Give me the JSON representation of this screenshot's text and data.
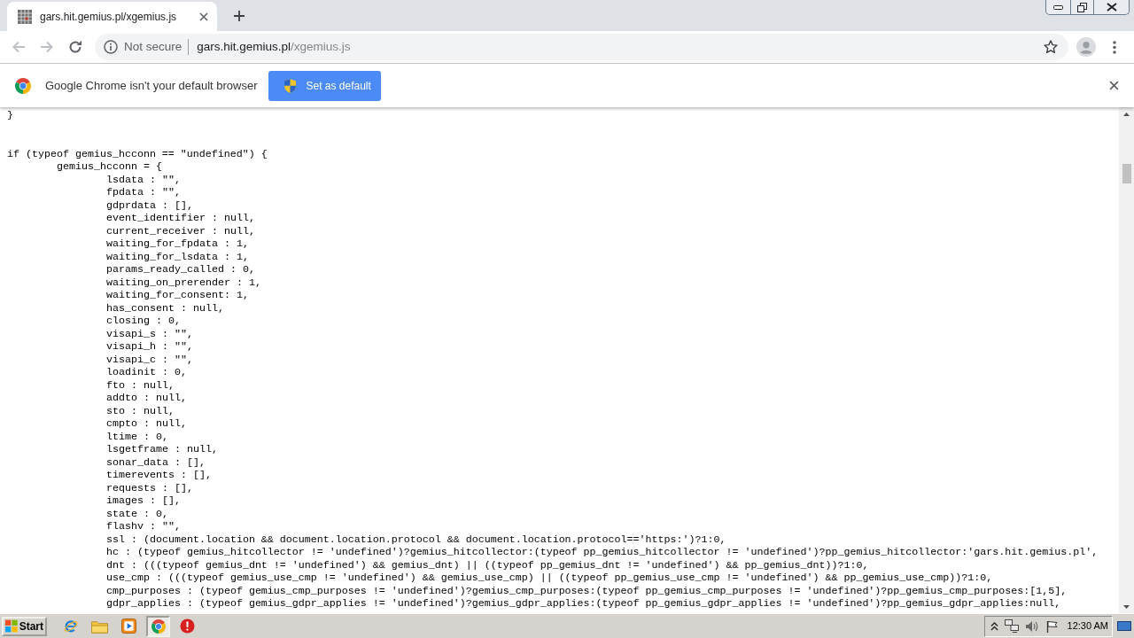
{
  "tabs": [
    {
      "title": "gars.hit.gemius.pl/xgemius.js",
      "selected": true
    }
  ],
  "toolbar": {
    "back": {
      "disabled": true
    },
    "forward": {
      "disabled": true
    },
    "omnibox": {
      "security": "Not secure",
      "host": "gars.hit.gemius.pl",
      "path": "/xgemius.js",
      "bookmarked": false
    }
  },
  "infobar": {
    "message": "Google Chrome isn't your default browser",
    "button": "Set as default"
  },
  "code": [
    [
      {
        "text": "}"
      }
    ],
    [
      {
        "text": "if (typeof gemius_hcconn == \"undefined\") {",
        "children": [
          {
            "text": "gemius_hcconn = {",
            "children": [
              {
                "text": "lsdata : \"\","
              },
              {
                "text": "fpdata : \"\","
              },
              {
                "text": "gdprdata : [],"
              },
              {
                "text": "event_identifier : null,"
              },
              {
                "text": "current_receiver : null,"
              },
              {
                "text": "waiting_for_fpdata : 1,"
              },
              {
                "text": "waiting_for_lsdata : 1,"
              },
              {
                "text": "params_ready_called : 0,"
              },
              {
                "text": "waiting_on_prerender : 1,"
              },
              {
                "text": "waiting_for_consent: 1,"
              },
              {
                "text": "has_consent : null,"
              },
              {
                "text": "closing : 0,"
              },
              {
                "text": "visapi_s : \"\","
              },
              {
                "text": "visapi_h : \"\","
              },
              {
                "text": "visapi_c : \"\","
              },
              {
                "text": "loadinit : 0,"
              },
              {
                "text": "fto : null,"
              },
              {
                "text": "addto : null,"
              },
              {
                "text": "sto : null,"
              },
              {
                "text": "cmpto : null,"
              },
              {
                "text": "ltime : 0,"
              },
              {
                "text": "lsgetframe : null,"
              },
              {
                "text": "sonar_data : [],"
              },
              {
                "text": "timerevents : [],"
              },
              {
                "text": "requests : [],"
              },
              {
                "text": "images : [],"
              },
              {
                "text": "state : 0,"
              },
              {
                "text": "flashv : \"\","
              },
              {
                "text": "ssl : (document.location && document.location.protocol && document.location.protocol=='https:')?1:0,"
              },
              {
                "text": "hc : (typeof gemius_hitcollector != 'undefined')?gemius_hitcollector:(typeof pp_gemius_hitcollector != 'undefined')?pp_gemius_hitcollector:'gars.hit.gemius.pl',"
              },
              {
                "text": "dnt : (((typeof gemius_dnt != 'undefined') && gemius_dnt) || ((typeof pp_gemius_dnt != 'undefined') && pp_gemius_dnt))?1:0,"
              },
              {
                "text": "use_cmp : (((typeof gemius_use_cmp != 'undefined') && gemius_use_cmp) || ((typeof pp_gemius_use_cmp != 'undefined') && pp_gemius_use_cmp))?1:0,"
              },
              {
                "text": "cmp_purposes : (typeof gemius_cmp_purposes != 'undefined')?gemius_cmp_purposes:(typeof pp_gemius_cmp_purposes != 'undefined')?pp_gemius_cmp_purposes:[1,5],"
              },
              {
                "text": "gdpr_applies : (typeof gemius_gdpr_applies != 'undefined')?gemius_gdpr_applies:(typeof pp_gemius_gdpr_applies != 'undefined')?pp_gemius_gdpr_applies:null,"
              }
            ]
          }
        ]
      }
    ]
  ],
  "taskbar": {
    "start": "Start",
    "apps": [
      {
        "kind": "ie",
        "active": false
      },
      {
        "kind": "folder",
        "active": false
      },
      {
        "kind": "media",
        "active": false
      },
      {
        "kind": "chrome",
        "active": true
      },
      {
        "kind": "alert",
        "active": false
      }
    ],
    "clock": "12:30 AM"
  }
}
